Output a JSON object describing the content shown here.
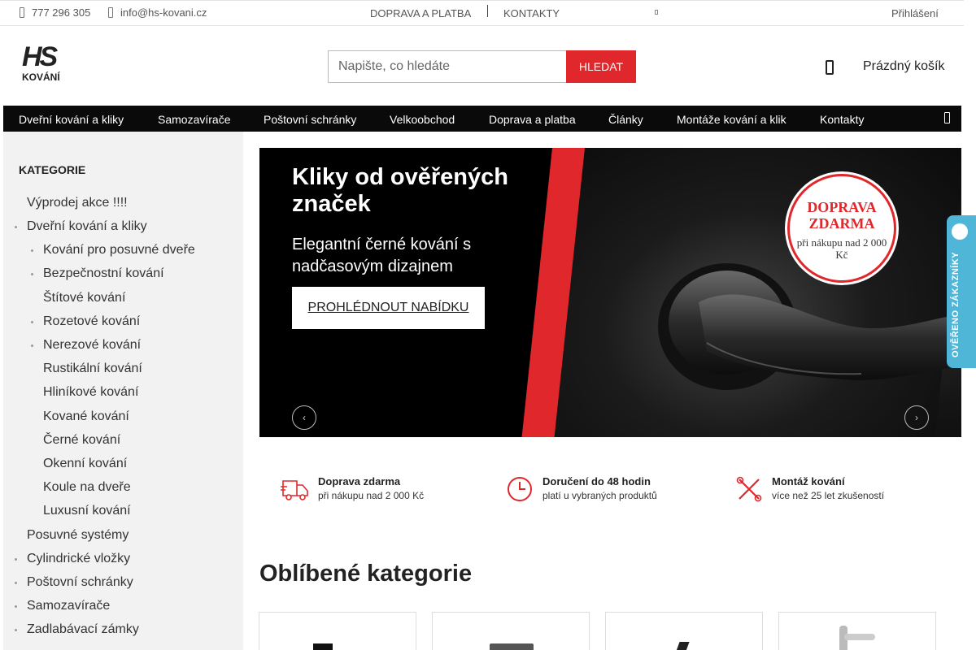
{
  "topbar": {
    "phone": "777 296 305",
    "email": "info@hs-kovani.cz",
    "links": [
      "DOPRAVA A PLATBA",
      "KONTAKTY"
    ],
    "login": "Přihlášení"
  },
  "header": {
    "logo_mark": "HS",
    "logo_text": "KOVÁNÍ",
    "search_placeholder": "Napište, co hledáte",
    "search_button": "HLEDAT",
    "cart_label": "Prázdný košík"
  },
  "nav": {
    "items": [
      "Dveřní kování a kliky",
      "Samozavírače",
      "Poštovní schránky",
      "Velkoobchod",
      "Doprava a platba",
      "Články",
      "Montáže kování a klik",
      "Kontakty"
    ]
  },
  "sidebar": {
    "title": "KATEGORIE",
    "items": [
      "Výprodej akce !!!!",
      "Dveřní kování a kliky",
      "Kování pro posuvné dveře",
      "Bezpečnostní kování",
      "Štítové kování",
      "Rozetové kování",
      "Nerezové kování",
      "Rustikální kování",
      "Hliníkové kování",
      "Kované kování",
      "Černé kování",
      "Okenní kování",
      "Koule na dveře",
      "Luxusní kování",
      "Posuvné systémy",
      "Cylindrické vložky",
      "Poštovní schránky",
      "Samozavírače",
      "Zadlabávací zámky"
    ]
  },
  "banner": {
    "title": "Kliky od ověřených značek",
    "subtitle": "Elegantní černé kování s nadčasovým dizajnem",
    "cta": "PROHLÉDNOUT NABÍDKU",
    "badge_line1": "DOPRAVA ZDARMA",
    "badge_line2": "při nákupu nad 2 000 Kč",
    "prev_icon": "chevron-left-icon",
    "next_icon": "chevron-right-icon"
  },
  "verified_badge": "OVĚŘENO ZÁKAZNÍKY",
  "features": [
    {
      "title": "Doprava zdarma",
      "subtitle": "při nákupu nad 2 000 Kč",
      "icon": "truck-icon"
    },
    {
      "title": "Doručení do 48 hodin",
      "subtitle": "platí u vybraných produktů",
      "icon": "clock-icon"
    },
    {
      "title": "Montáž kování",
      "subtitle": "více než 25 let zkušeností",
      "icon": "tools-icon"
    }
  ],
  "categories_heading": "Oblíbené kategorie",
  "colors": {
    "accent": "#e0282c",
    "nav_bg": "#0a0a0a",
    "sidebar_bg": "#f2f2f2",
    "verified": "#4fb6d8"
  }
}
